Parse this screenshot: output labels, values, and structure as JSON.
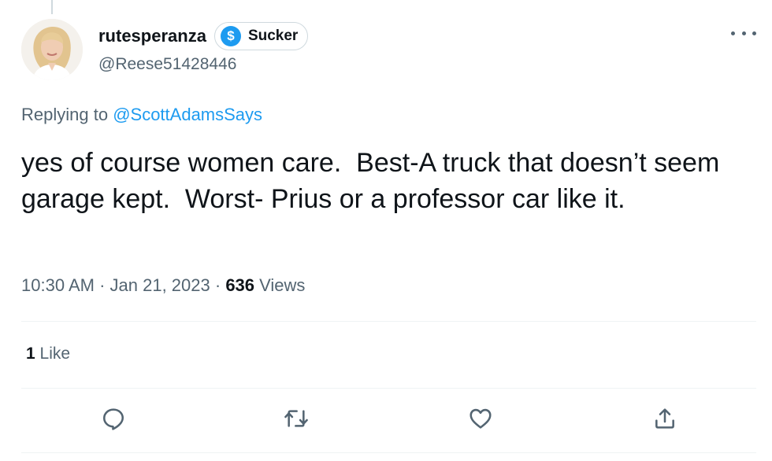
{
  "author": {
    "display_name": "rutesperanza",
    "badge_label": "Sucker",
    "badge_symbol": "$",
    "handle": "@Reese51428446"
  },
  "reply": {
    "prefix": "Replying to ",
    "mention": "@ScottAdamsSays"
  },
  "tweet": {
    "text": "yes of course women care.  Best-A truck that doesn’t seem garage kept.  Worst- Prius or a professor car like it."
  },
  "meta": {
    "time": "10:30 AM",
    "sep1": " · ",
    "date": "Jan 21, 2023",
    "sep2": " · ",
    "views_count": "636",
    "views_label": " Views"
  },
  "stats": {
    "like_count": "1",
    "like_label": " Like"
  },
  "icons": {
    "more": "more-horizontal-icon",
    "reply": "reply-icon",
    "retweet": "retweet-icon",
    "like": "heart-icon",
    "share": "share-icon",
    "badge": "dollar-icon"
  },
  "colors": {
    "accent": "#1d9bf0",
    "text": "#0f1419",
    "secondary": "#536471",
    "divider": "#eff3f4"
  }
}
